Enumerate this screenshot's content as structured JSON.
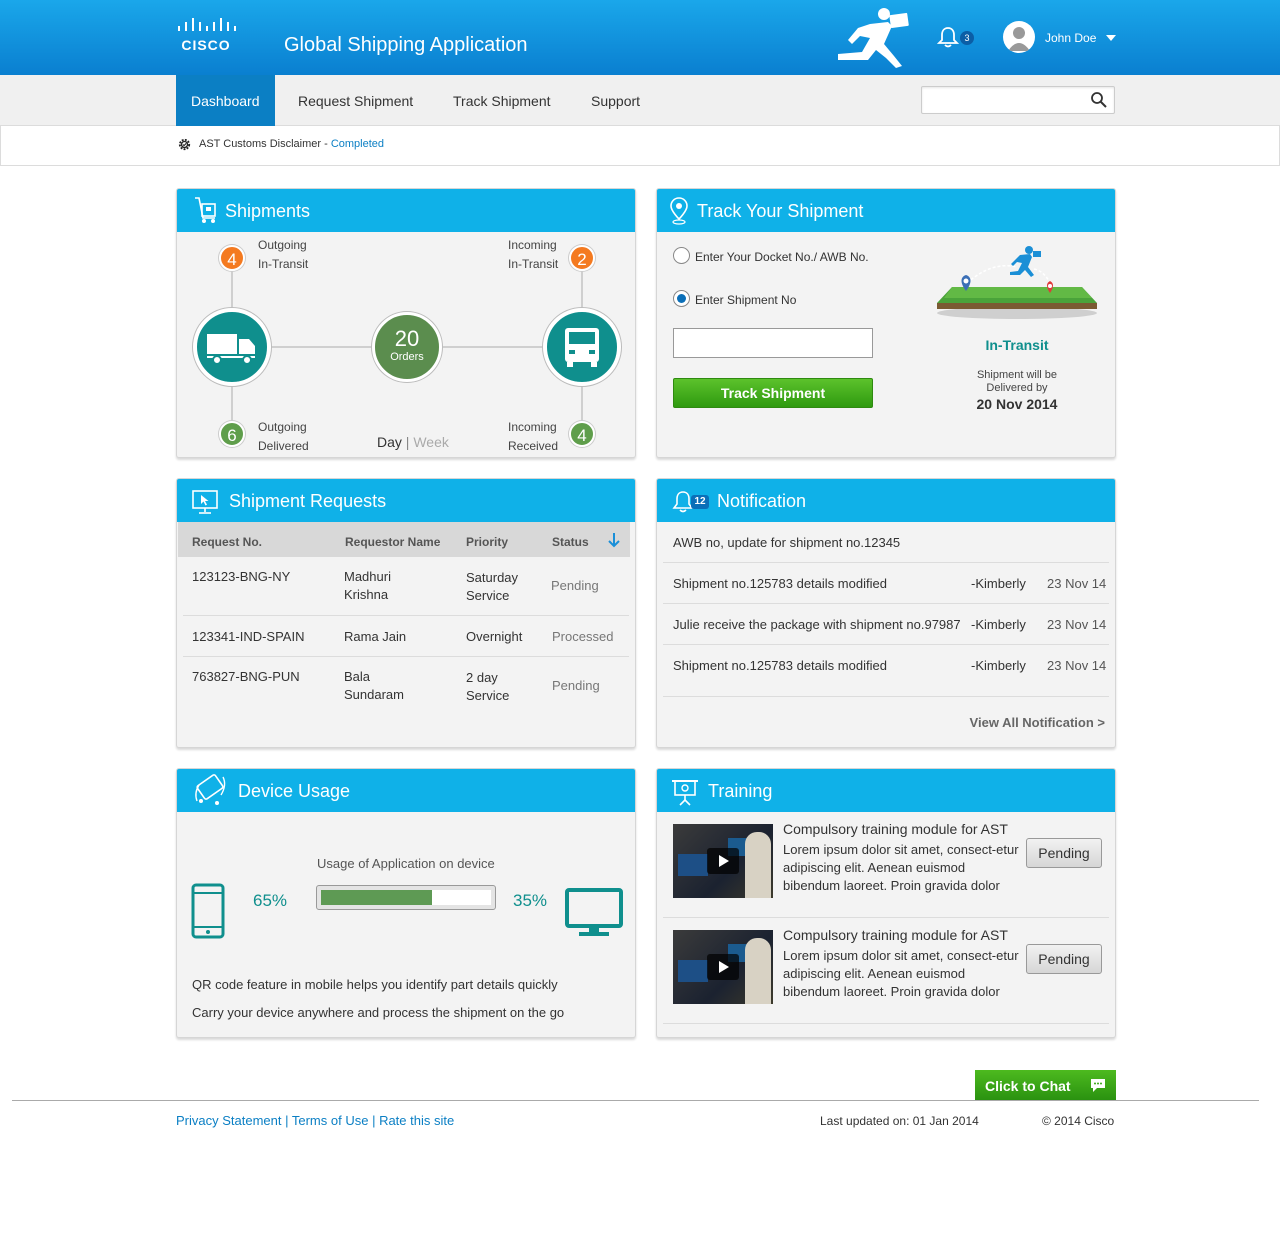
{
  "header": {
    "logo_text": "CISCO",
    "app_title": "Global Shipping Application",
    "notification_count": "3",
    "user_name": "John Doe"
  },
  "nav": {
    "items": [
      "Dashboard",
      "Request Shipment",
      "Track Shipment",
      "Support"
    ],
    "active": "Dashboard",
    "search_value": ""
  },
  "disclaimer": {
    "text": "AST Customs Disclaimer - ",
    "status": "Completed"
  },
  "shipments": {
    "title": "Shipments",
    "outgoing_transit": {
      "count": "4",
      "label1": "Outgoing",
      "label2": "In-Transit"
    },
    "incoming_transit": {
      "count": "2",
      "label1": "Incoming",
      "label2": "In-Transit"
    },
    "outgoing_delivered": {
      "count": "6",
      "label1": "Outgoing",
      "label2": "Delivered"
    },
    "incoming_received": {
      "count": "4",
      "label1": "Incoming",
      "label2": "Received"
    },
    "orders_count": "20",
    "orders_label": "Orders",
    "period_day": "Day",
    "period_sep": "|",
    "period_week": "Week"
  },
  "track": {
    "title": "Track Your Shipment",
    "option1": "Enter Your Docket No./ AWB No.",
    "option2": "Enter Shipment No",
    "input_value": "",
    "button": "Track Shipment",
    "status": "In-Transit",
    "note_line1": "Shipment will be",
    "note_line2": "Delivered by",
    "date": "20 Nov 2014"
  },
  "requests": {
    "title": "Shipment Requests",
    "columns": [
      "Request No.",
      "Requestor Name",
      "Priority",
      "Status"
    ],
    "rows": [
      {
        "id": "123123-BNG-NY",
        "name1": "Madhuri",
        "name2": "Krishna",
        "pri1": "Saturday",
        "pri2": "Service",
        "status": "Pending"
      },
      {
        "id": "123341-IND-SPAIN",
        "name1": "Rama Jain",
        "name2": "",
        "pri1": "Overnight",
        "pri2": "",
        "status": "Processed"
      },
      {
        "id": "763827-BNG-PUN",
        "name1": "Bala",
        "name2": "Sundaram",
        "pri1": "2 day",
        "pri2": "Service",
        "status": "Pending"
      }
    ]
  },
  "notifications": {
    "title": "Notification",
    "badge": "12",
    "items": [
      {
        "text": "AWB no, update for shipment no.12345",
        "by": "",
        "date": ""
      },
      {
        "text": "Shipment no.125783 details modified",
        "by": "-Kimberly",
        "date": "23 Nov 14"
      },
      {
        "text": "Julie receive the package with shipment no.97987",
        "by": "-Kimberly",
        "date": "23 Nov 14"
      },
      {
        "text": "Shipment no.125783 details modified",
        "by": "-Kimberly",
        "date": "23 Nov 14"
      }
    ],
    "view_all": "View All Notification >"
  },
  "device": {
    "title": "Device Usage",
    "usage_title": "Usage of Application on device",
    "mobile_pct": "65%",
    "desktop_pct": "35%",
    "mobile_fraction": 0.65,
    "line1": "QR code feature in mobile helps you identify part details quickly",
    "line2": "Carry your device anywhere and process the shipment on the go"
  },
  "training": {
    "title": "Training",
    "items": [
      {
        "title": "Compulsory training module for AST",
        "desc": "Lorem ipsum dolor sit amet, consect-etur adipiscing elit. Aenean euismod bibendum laoreet. Proin gravida dolor",
        "button": "Pending"
      },
      {
        "title": "Compulsory training module for AST",
        "desc": "Lorem ipsum dolor sit amet, consect-etur adipiscing elit. Aenean euismod bibendum laoreet. Proin gravida dolor",
        "button": "Pending"
      }
    ]
  },
  "footer": {
    "chat": "Click to Chat",
    "links": [
      "Privacy Statement",
      "Terms of Use",
      "Rate this site"
    ],
    "link_sep": " | ",
    "updated": "Last updated on: 01 Jan 2014",
    "copyright": "© 2014 Cisco"
  },
  "colors": {
    "header_blue": "#0a8fdc",
    "card_header": "#0fb1e8",
    "teal": "#0f8f8d",
    "orange": "#f47a20",
    "green": "#5f9e4b",
    "button_green": "#3aa816"
  }
}
